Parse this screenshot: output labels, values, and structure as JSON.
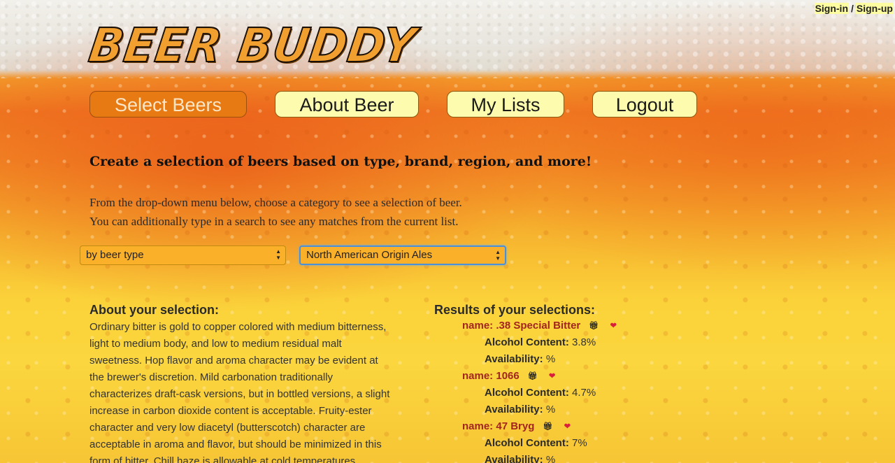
{
  "auth": {
    "signin": "Sign-in",
    "separator": "/",
    "signup": "Sign-up"
  },
  "logo": "BEER BUDDY",
  "nav": {
    "select_beers": "Select Beers",
    "about_beer": "About Beer",
    "my_lists": "My Lists",
    "logout": "Logout"
  },
  "headline": "Create a selection of beers based on type, brand, region, and more!",
  "intro": {
    "line1": "From the drop-down menu below, choose a category to see a selection of beer.",
    "line2": "You can additionally type in a search to see any matches from the current list."
  },
  "filters": {
    "category": "by beer type",
    "subcategory": "North American Origin Ales"
  },
  "about": {
    "title": "About your selection:",
    "lines": [
      "Ordinary bitter is gold to copper colored with medium bitterness,",
      "light to medium body, and low to medium residual malt",
      "sweetness. Hop flavor and aroma character may be evident at",
      "the brewer's discretion. Mild carbonation traditionally",
      "characterizes draft-cask versions, but in bottled versions, a slight",
      "increase in carbon dioxide content is acceptable. Fruity-ester",
      "character and very low diacetyl (butterscotch) character are",
      "acceptable in aroma and flavor, but should be minimized in this",
      "form of bitter. Chill haze is allowable at cold temperatures."
    ]
  },
  "results": {
    "title": "Results of your selections:",
    "name_prefix": "name:",
    "alcohol_label": "Alcohol Content:",
    "availability_label": "Availability:",
    "items": [
      {
        "name": ".38 Special Bitter",
        "alcohol": "3.8%",
        "availability": "%"
      },
      {
        "name": "1066",
        "alcohol": "4.7%",
        "availability": "%"
      },
      {
        "name": "47 Bryg",
        "alcohol": "7%",
        "availability": "%"
      }
    ]
  },
  "icons": {
    "gift": "gift-icon",
    "heart": "heart-icon"
  }
}
